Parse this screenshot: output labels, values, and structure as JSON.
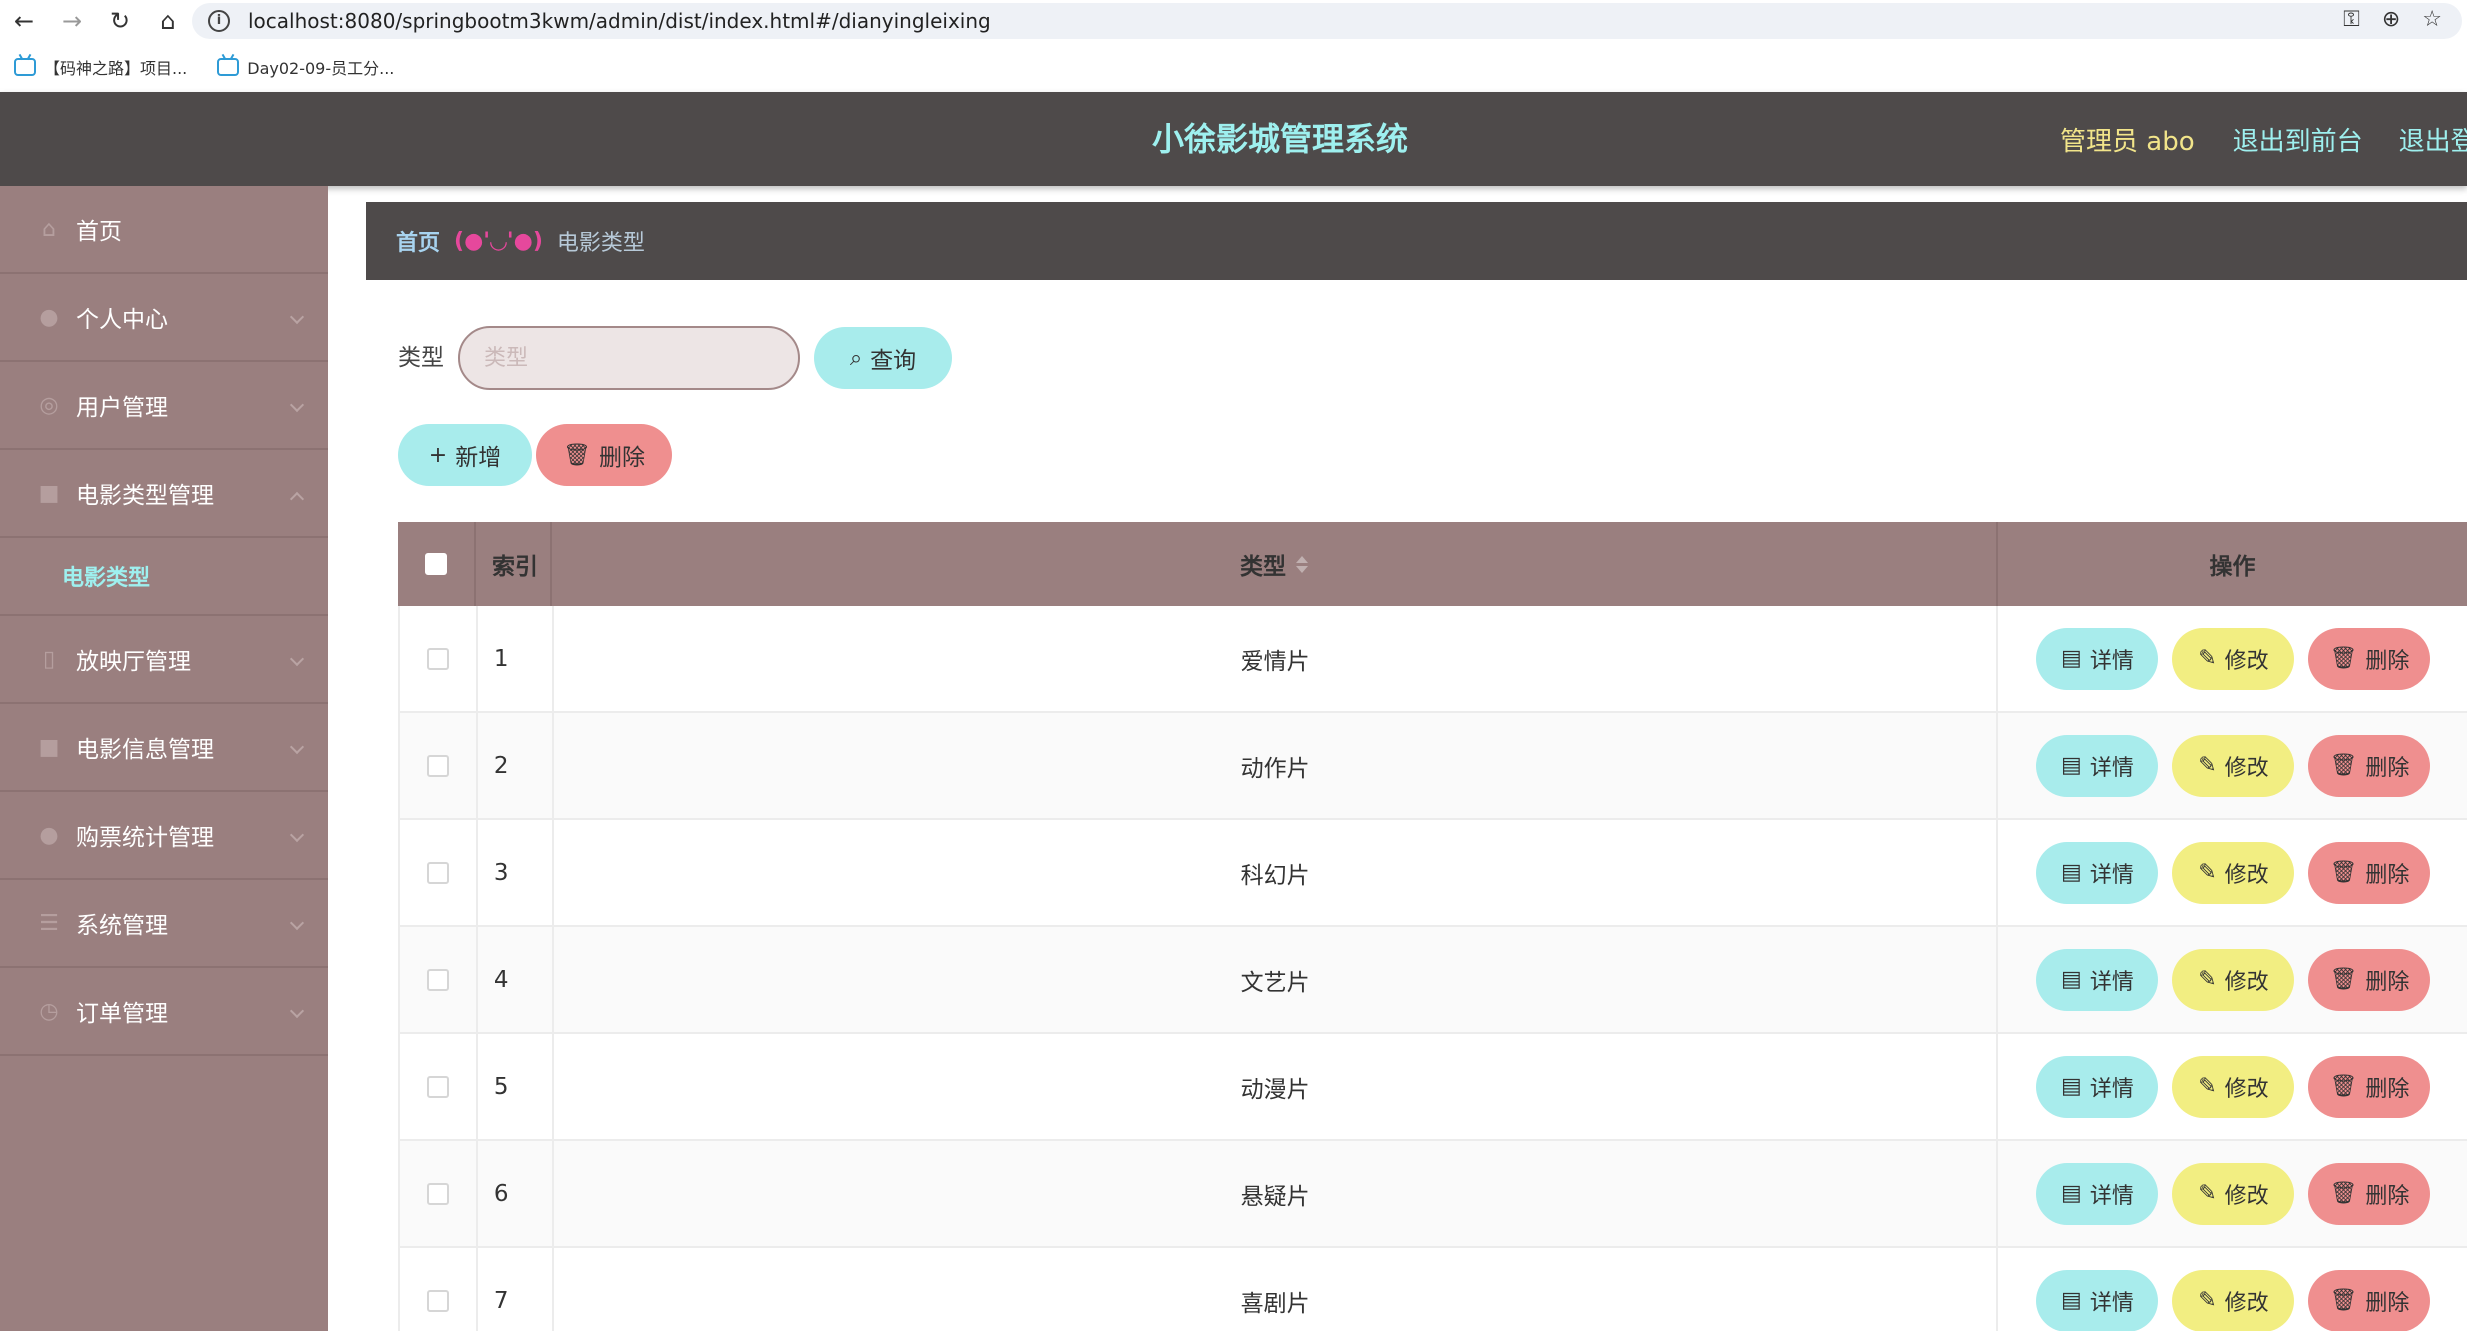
{
  "browser": {
    "url": "localhost:8080/springbootm3kwm/admin/dist/index.html#/dianyingleixing",
    "bookmarks": [
      {
        "label": "【码神之路】项目..."
      },
      {
        "label": "Day02-09-员工分..."
      }
    ]
  },
  "header": {
    "title": "小徐影城管理系统",
    "admin": "管理员 abo",
    "back_front": "退出到前台",
    "logout": "退出登"
  },
  "sidebar": {
    "items": [
      {
        "label": "首页",
        "icon": "home-icon"
      },
      {
        "label": "个人中心",
        "icon": "user-icon"
      },
      {
        "label": "用户管理",
        "icon": "users-icon"
      },
      {
        "label": "电影类型管理",
        "icon": "briefcase-icon"
      },
      {
        "label": "放映厅管理",
        "icon": "mobile-icon"
      },
      {
        "label": "电影信息管理",
        "icon": "briefcase-icon"
      },
      {
        "label": "购票统计管理",
        "icon": "user-icon"
      },
      {
        "label": "系统管理",
        "icon": "list-icon"
      },
      {
        "label": "订单管理",
        "icon": "clock-icon"
      }
    ],
    "sub_active": "电影类型"
  },
  "breadcrumb": {
    "home": "首页",
    "separator": "(●'◡'●)",
    "current": "电影类型"
  },
  "search": {
    "label": "类型",
    "placeholder": "类型",
    "button": "查询"
  },
  "actions": {
    "add": "新增",
    "delete": "删除"
  },
  "table": {
    "headers": {
      "index": "索引",
      "type": "类型",
      "ops": "操作"
    },
    "row_buttons": {
      "detail": "详情",
      "edit": "修改",
      "delete": "删除"
    },
    "rows": [
      {
        "index": "1",
        "type": "爱情片"
      },
      {
        "index": "2",
        "type": "动作片"
      },
      {
        "index": "3",
        "type": "科幻片"
      },
      {
        "index": "4",
        "type": "文艺片"
      },
      {
        "index": "5",
        "type": "动漫片"
      },
      {
        "index": "6",
        "type": "悬疑片"
      },
      {
        "index": "7",
        "type": "喜剧片"
      }
    ]
  },
  "colors": {
    "header_bg": "#4e4a4a",
    "sidebar_bg": "#9a7f7f",
    "accent_cyan": "#a8ecec",
    "accent_red": "#ef8f8f",
    "accent_yellow": "#f2ee82",
    "admin_yellow": "#f2e58a"
  }
}
